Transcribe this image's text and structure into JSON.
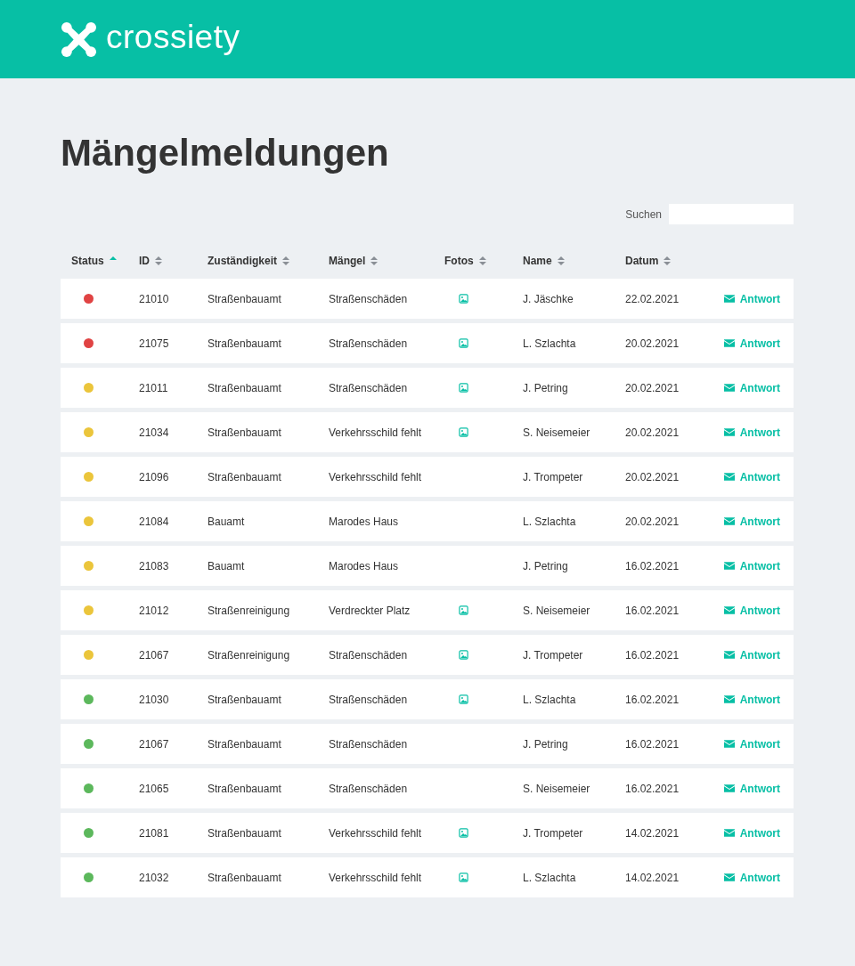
{
  "brand": "crossiety",
  "title": "Mängelmeldungen",
  "search": {
    "label": "Suchen"
  },
  "columns": [
    {
      "label": "Status",
      "sorted": true
    },
    {
      "label": "ID",
      "sorted": false
    },
    {
      "label": "Zuständigkeit",
      "sorted": false
    },
    {
      "label": "Mängel",
      "sorted": false
    },
    {
      "label": "Fotos",
      "sorted": false
    },
    {
      "label": "Name",
      "sorted": false
    },
    {
      "label": "Datum",
      "sorted": false
    }
  ],
  "rows": [
    {
      "color": "#e04343",
      "id": "21010",
      "dept": "Straßenbauamt",
      "issue": "Straßenschäden",
      "photo": true,
      "name": "J. Jäschke",
      "date": "22.02.2021",
      "action": "Antwort"
    },
    {
      "color": "#e04343",
      "id": "21075",
      "dept": "Straßenbauamt",
      "issue": "Straßenschäden",
      "photo": true,
      "name": "L. Szlachta",
      "date": "20.02.2021",
      "action": "Antwort"
    },
    {
      "color": "#ebc53b",
      "id": "21011",
      "dept": "Straßenbauamt",
      "issue": "Straßenschäden",
      "photo": true,
      "name": "J. Petring",
      "date": "20.02.2021",
      "action": "Antwort"
    },
    {
      "color": "#ebc53b",
      "id": "21034",
      "dept": "Straßenbauamt",
      "issue": "Verkehrsschild fehlt",
      "photo": true,
      "name": "S. Neisemeier",
      "date": "20.02.2021",
      "action": "Antwort"
    },
    {
      "color": "#ebc53b",
      "id": "21096",
      "dept": "Straßenbauamt",
      "issue": "Verkehrsschild fehlt",
      "photo": false,
      "name": "J. Trompeter",
      "date": "20.02.2021",
      "action": "Antwort"
    },
    {
      "color": "#ebc53b",
      "id": "21084",
      "dept": "Bauamt",
      "issue": "Marodes Haus",
      "photo": false,
      "name": "L. Szlachta",
      "date": "20.02.2021",
      "action": "Antwort"
    },
    {
      "color": "#ebc53b",
      "id": "21083",
      "dept": "Bauamt",
      "issue": "Marodes Haus",
      "photo": false,
      "name": "J. Petring",
      "date": "16.02.2021",
      "action": "Antwort"
    },
    {
      "color": "#ebc53b",
      "id": "21012",
      "dept": "Straßenreinigung",
      "issue": "Verdreckter Platz",
      "photo": true,
      "name": "S. Neisemeier",
      "date": "16.02.2021",
      "action": "Antwort"
    },
    {
      "color": "#ebc53b",
      "id": "21067",
      "dept": "Straßenreinigung",
      "issue": "Straßenschäden",
      "photo": true,
      "name": "J. Trompeter",
      "date": "16.02.2021",
      "action": "Antwort"
    },
    {
      "color": "#5cb85c",
      "id": "21030",
      "dept": "Straßenbauamt",
      "issue": "Straßenschäden",
      "photo": true,
      "name": "L. Szlachta",
      "date": "16.02.2021",
      "action": "Antwort"
    },
    {
      "color": "#5cb85c",
      "id": "21067",
      "dept": "Straßenbauamt",
      "issue": "Straßenschäden",
      "photo": false,
      "name": "J. Petring",
      "date": "16.02.2021",
      "action": "Antwort"
    },
    {
      "color": "#5cb85c",
      "id": "21065",
      "dept": "Straßenbauamt",
      "issue": "Straßenschäden",
      "photo": false,
      "name": "S. Neisemeier",
      "date": "16.02.2021",
      "action": "Antwort"
    },
    {
      "color": "#5cb85c",
      "id": "21081",
      "dept": "Straßenbauamt",
      "issue": "Verkehrsschild fehlt",
      "photo": true,
      "name": "J. Trompeter",
      "date": "14.02.2021",
      "action": "Antwort"
    },
    {
      "color": "#5cb85c",
      "id": "21032",
      "dept": "Straßenbauamt",
      "issue": "Verkehrsschild fehlt",
      "photo": true,
      "name": "L. Szlachta",
      "date": "14.02.2021",
      "action": "Antwort"
    }
  ]
}
